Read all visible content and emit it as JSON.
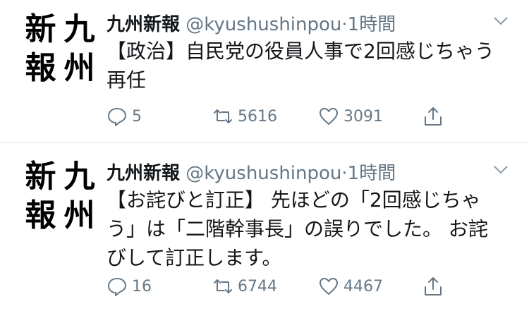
{
  "tweets": [
    {
      "avatar_chars": [
        "九",
        "新",
        "州",
        "報"
      ],
      "name": "九州新報",
      "handle": "@kyushushinpou",
      "separator": "·",
      "time": "1時間",
      "text_lines": [
        "【政治】自民党の役員人事で2回感じちゃう",
        "再任"
      ],
      "replies": "5",
      "retweets": "5616",
      "likes": "3091"
    },
    {
      "avatar_chars": [
        "九",
        "新",
        "州",
        "報"
      ],
      "name": "九州新報",
      "handle": "@kyushushinpou",
      "separator": "·",
      "time": "1時間",
      "text_lines": [
        "【お詫びと訂正】 先ほどの「2回感じちゃ",
        "う」は「二階幹事長」の誤りでした。 お詫",
        "びして訂正します。"
      ],
      "replies": "16",
      "retweets": "6744",
      "likes": "4467"
    }
  ],
  "icons": {
    "reply": "reply-icon",
    "retweet": "retweet-icon",
    "like": "heart-icon",
    "share": "share-icon",
    "menu": "chevron-down-icon"
  },
  "colors": {
    "text": "#14171a",
    "secondary": "#657786",
    "divider": "#e1e8ed"
  }
}
